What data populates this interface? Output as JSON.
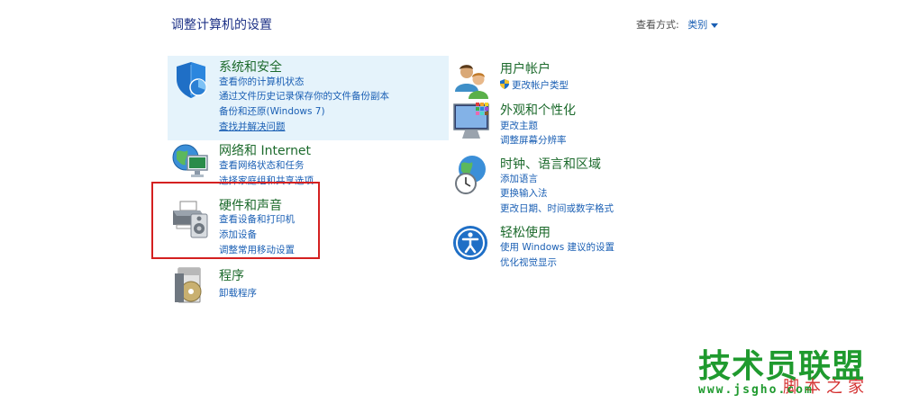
{
  "header": {
    "title": "调整计算机的设置",
    "view_by_label": "查看方式:",
    "view_by_value": "类别"
  },
  "categories": {
    "system_security": {
      "title": "系统和安全",
      "links": [
        "查看你的计算机状态",
        "通过文件历史记录保存你的文件备份副本",
        "备份和还原(Windows 7)",
        "查找并解决问题"
      ]
    },
    "network": {
      "title": "网络和 Internet",
      "links": [
        "查看网络状态和任务",
        "选择家庭组和共享选项"
      ]
    },
    "hardware_sound": {
      "title": "硬件和声音",
      "links": [
        "查看设备和打印机",
        "添加设备",
        "调整常用移动设置"
      ]
    },
    "programs": {
      "title": "程序",
      "links": [
        "卸载程序"
      ]
    },
    "user_accounts": {
      "title": "用户帐户",
      "links": [
        "更改帐户类型"
      ]
    },
    "appearance": {
      "title": "外观和个性化",
      "links": [
        "更改主题",
        "调整屏幕分辨率"
      ]
    },
    "clock_region": {
      "title": "时钟、语言和区域",
      "links": [
        "添加语言",
        "更换输入法",
        "更改日期、时间或数字格式"
      ]
    },
    "ease_of_access": {
      "title": "轻松使用",
      "links": [
        "使用 Windows 建议的设置",
        "优化视觉显示"
      ]
    }
  },
  "watermark": {
    "main": "技术员联盟",
    "side": "脚本之家",
    "url": "www.jsgho.com"
  },
  "colors": {
    "category_title": "#1c6a2c",
    "link": "#1a5fb4",
    "highlight_background": "#e5f3fb",
    "annotation_frame": "#d42020",
    "watermark": "#1f9a2e"
  },
  "icons": {
    "system_security": "shield-icon",
    "network": "globe-network-icon",
    "hardware_sound": "printer-speaker-icon",
    "programs": "programs-disc-icon",
    "user_accounts": "users-icon",
    "appearance": "monitor-palette-icon",
    "clock_region": "clock-globe-icon",
    "ease_of_access": "accessibility-icon",
    "uac": "uac-shield-icon"
  }
}
